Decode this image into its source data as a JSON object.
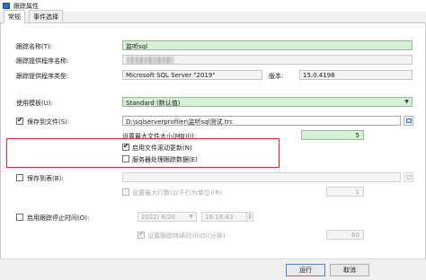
{
  "window": {
    "title": "跟踪属性"
  },
  "tabs": [
    {
      "label": "常规"
    },
    {
      "label": "事件选择"
    }
  ],
  "general": {
    "trace_name": {
      "label": "跟踪名称(T):",
      "value": "监听sql"
    },
    "provider_name": {
      "label": "跟踪提供程序名称:",
      "value": ""
    },
    "provider_type": {
      "label": "跟踪提供程序类型:",
      "value": "Microsoft SQL Server \"2019\""
    },
    "version": {
      "label": "版本:",
      "value": "15.0.4198"
    },
    "template": {
      "label": "使用模板(U):",
      "value": "Standard (默认值)"
    },
    "save_to_file": {
      "label": "保存到文件(S):",
      "checked": true,
      "path": "D:\\sqlserverprofiler\\监听sql测试.trc",
      "max_size_label": "设置最大文件大小(MB)(I):",
      "max_size_value": "5",
      "rollover_label": "启用文件滚动更新(N)",
      "rollover_checked": true,
      "server_process_label": "服务器处理跟踪数据(E)",
      "server_process_checked": false
    },
    "save_to_table": {
      "label": "保存到表(B):",
      "checked": false,
      "table": "",
      "max_rows_label": "设置最大行数(以千行为单位)(R):",
      "max_rows_checked": false,
      "max_rows_value": "1"
    },
    "stop_time": {
      "label": "启用跟踪停止时间(O):",
      "checked": false,
      "date": "2022/ 8/26",
      "time": "16:16:43",
      "duration_label": "设置跟踪持续时间(D)(分钟)",
      "duration_checked": true,
      "duration_value": "60"
    }
  },
  "buttons": {
    "run": "运行",
    "cancel": "取消"
  }
}
